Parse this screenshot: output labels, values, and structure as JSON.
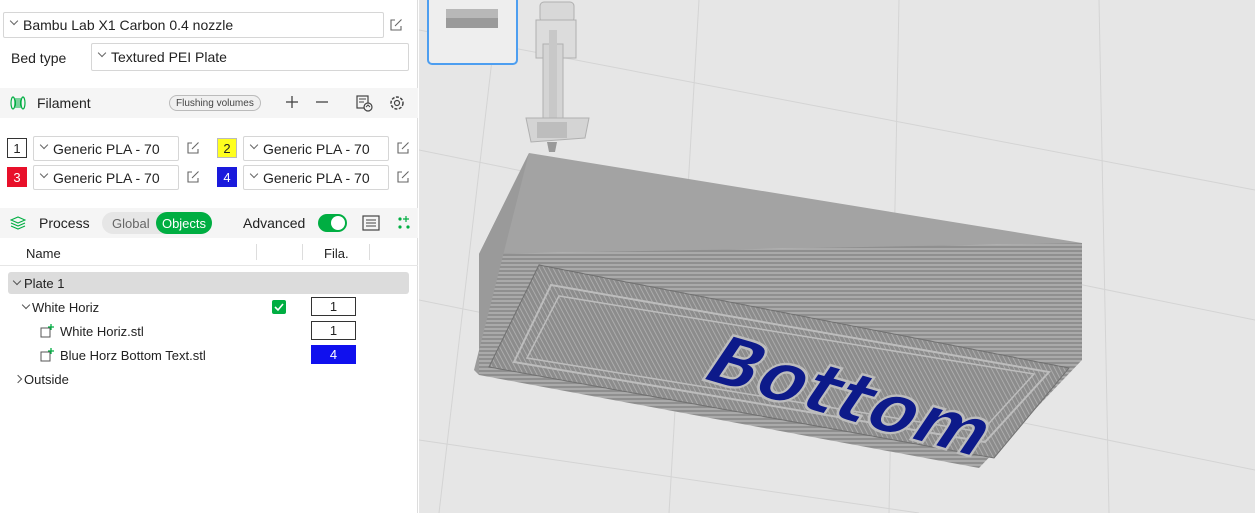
{
  "printer": {
    "name": "Bambu Lab X1 Carbon 0.4 nozzle"
  },
  "bed": {
    "label": "Bed type",
    "value": "Textured PEI Plate"
  },
  "filament": {
    "title": "Filament",
    "flushing_label": "Flushing volumes",
    "slots": [
      {
        "num": "1",
        "color": "#ffffff",
        "text_color": "#222222",
        "name": "Generic PLA - 70"
      },
      {
        "num": "2",
        "color": "#ffff1e",
        "text_color": "#222222",
        "name": "Generic PLA - 70"
      },
      {
        "num": "3",
        "color": "#e8102a",
        "text_color": "#ffffff",
        "name": "Generic PLA - 70"
      },
      {
        "num": "4",
        "color": "#1a1adc",
        "text_color": "#ffffff",
        "name": "Generic PLA - 70"
      }
    ]
  },
  "process": {
    "title": "Process",
    "global_label": "Global",
    "objects_label": "Objects",
    "advanced_label": "Advanced",
    "advanced_on": true
  },
  "table": {
    "col_name": "Name",
    "col_fila": "Fila."
  },
  "tree": {
    "plate": "Plate 1",
    "object": {
      "name": "White Horiz",
      "checked": true,
      "fila": "1"
    },
    "parts": [
      {
        "name": "White Horiz.stl",
        "fila": "1",
        "fila_color": "#ffffff",
        "fila_text": "#222222"
      },
      {
        "name": "Blue Horz Bottom Text.stl",
        "fila": "4",
        "fila_color": "#1010ee",
        "fila_text": "#ffffff"
      }
    ],
    "outside": "Outside"
  },
  "viewport": {
    "model_text": "Bottom",
    "accent": "#4d9ef0",
    "bed_color": "#e6e6e6",
    "model_color": "#8a8a8a",
    "text_color": "#0d1a8a"
  }
}
